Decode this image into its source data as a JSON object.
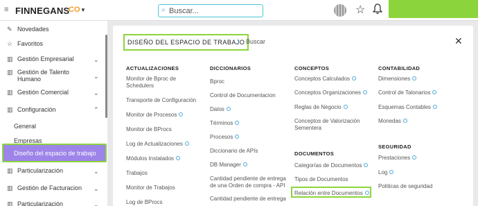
{
  "header": {
    "logo_text": "FINNEGANS",
    "logo_mark": "CO",
    "search_placeholder": "Buscar...",
    "accent_color": "#8cd43c"
  },
  "sidebar": {
    "items": [
      {
        "label": "Novedades",
        "icon": "pin-icon"
      },
      {
        "label": "Favoritos",
        "icon": "star-icon"
      },
      {
        "label": "Gestión Empresarial",
        "icon": "building-icon"
      },
      {
        "label": "Gestión de Talento Humano",
        "icon": "building-icon"
      },
      {
        "label": "Gestión Comercial",
        "icon": "building-icon"
      },
      {
        "label": "Configuración",
        "icon": "building-icon"
      },
      {
        "label": "General"
      },
      {
        "label": "Empresas"
      },
      {
        "label": "Diseño del espacio de trabajo"
      },
      {
        "label": "Particularización",
        "icon": "building-icon"
      },
      {
        "label": "Gestión de Facturacion",
        "icon": "building-icon"
      },
      {
        "label": "Particularización",
        "icon": "building-icon"
      }
    ]
  },
  "panel": {
    "title": "DISEÑO DEL ESPACIO DE TRABAJO",
    "search_placeholder": "Buscar",
    "columns": [
      {
        "heading": "ACTUALIZACIONES",
        "links": [
          "Monitor de Bproc de Schedulers",
          "Transporte de Configuración",
          "Monitor de Procesos",
          "Monitor de BProcs",
          "Log de Actualizaciones",
          "Módulos Instalados",
          "Trabajos",
          "Monitor de Trabajos",
          "Log de BProcs"
        ]
      },
      {
        "heading": "DICCIONARIOS",
        "links": [
          "Bproc",
          "Control de Documentacion",
          "Datos",
          "Términos",
          "Procesos",
          "Diccionario de APIs",
          "DB Manager",
          "Cantidad pendiente de entrega de una Orden de compra - API",
          "Cantidad pendiente de entrega"
        ]
      },
      {
        "heading": "CONCEPTOS",
        "links": [
          "Conceptos Calculados",
          "Conceptos Organizaciones",
          "Reglas de Negocio",
          "Conceptos de Valorización Sementera"
        ],
        "heading2": "DOCUMENTOS",
        "links2": [
          "Categorías de Documentos",
          "Tipos de Documentos",
          "Relación entre Documentos"
        ]
      },
      {
        "heading": "CONTABILIDAD",
        "links": [
          "Dimensiones",
          "Control de Talonarios",
          "Esquemas Contables",
          "Monedas"
        ],
        "heading2": "SEGURIDAD",
        "links2": [
          "Prestaciones",
          "Log",
          "Politicas de seguridad"
        ]
      }
    ]
  }
}
